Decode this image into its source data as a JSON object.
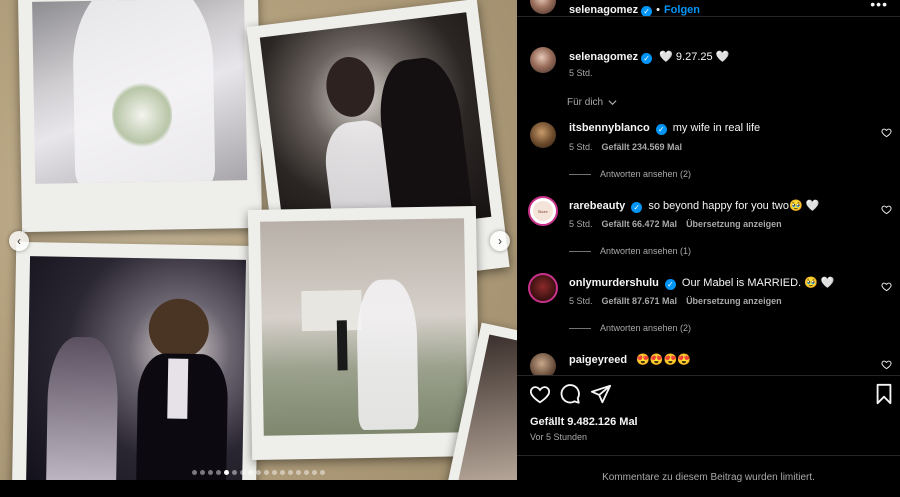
{
  "header": {
    "username": "selenagomez",
    "separator": "•",
    "follow_label": "Folgen",
    "more_icon": "more-horizontal-icon"
  },
  "caption": {
    "username": "selenagomez",
    "text": "🤍 9.27.25 🤍",
    "time": "5 Std."
  },
  "sort": {
    "label": "Für dich",
    "icon": "chevron-down-icon"
  },
  "comments": [
    {
      "username": "itsbennyblanco",
      "text": "my wife in real life",
      "time": "5 Std.",
      "likes": "Gefällt 234.569 Mal",
      "translate": "",
      "replies": "Antworten ansehen (2)"
    },
    {
      "username": "rarebeauty",
      "text": "so beyond happy for you two🥹 🤍",
      "time": "5 Std.",
      "likes": "Gefällt 66.472 Mal",
      "translate": "Übersetzung anzeigen",
      "replies": "Antworten ansehen (1)",
      "avatar_text": "Rare Beauty"
    },
    {
      "username": "onlymurdershulu",
      "text": "Our Mabel is MARRIED. 🥹 🤍",
      "time": "5 Std.",
      "likes": "Gefällt 87.671 Mal",
      "translate": "Übersetzung anzeigen",
      "replies": "Antworten ansehen (2)"
    },
    {
      "username": "paigeyreed",
      "text": "😍😍😍😍",
      "time": "",
      "likes": "",
      "translate": "",
      "replies": ""
    }
  ],
  "actions": {
    "like_icon": "heart-icon",
    "comment_icon": "comment-icon",
    "share_icon": "share-icon",
    "save_icon": "bookmark-icon"
  },
  "post_likes": "Gefällt 9.482.126 Mal",
  "post_time": "Vor 5 Stunden",
  "comments_limited": "Kommentare zu diesem Beitrag wurden limitiert.",
  "carousel": {
    "prev_label": "‹",
    "next_label": "›",
    "slide_count": 17,
    "active_index": 4
  },
  "colors": {
    "accent": "#0095f6",
    "secondary_text": "#a8a8a8",
    "panel_bg": "#000000"
  }
}
